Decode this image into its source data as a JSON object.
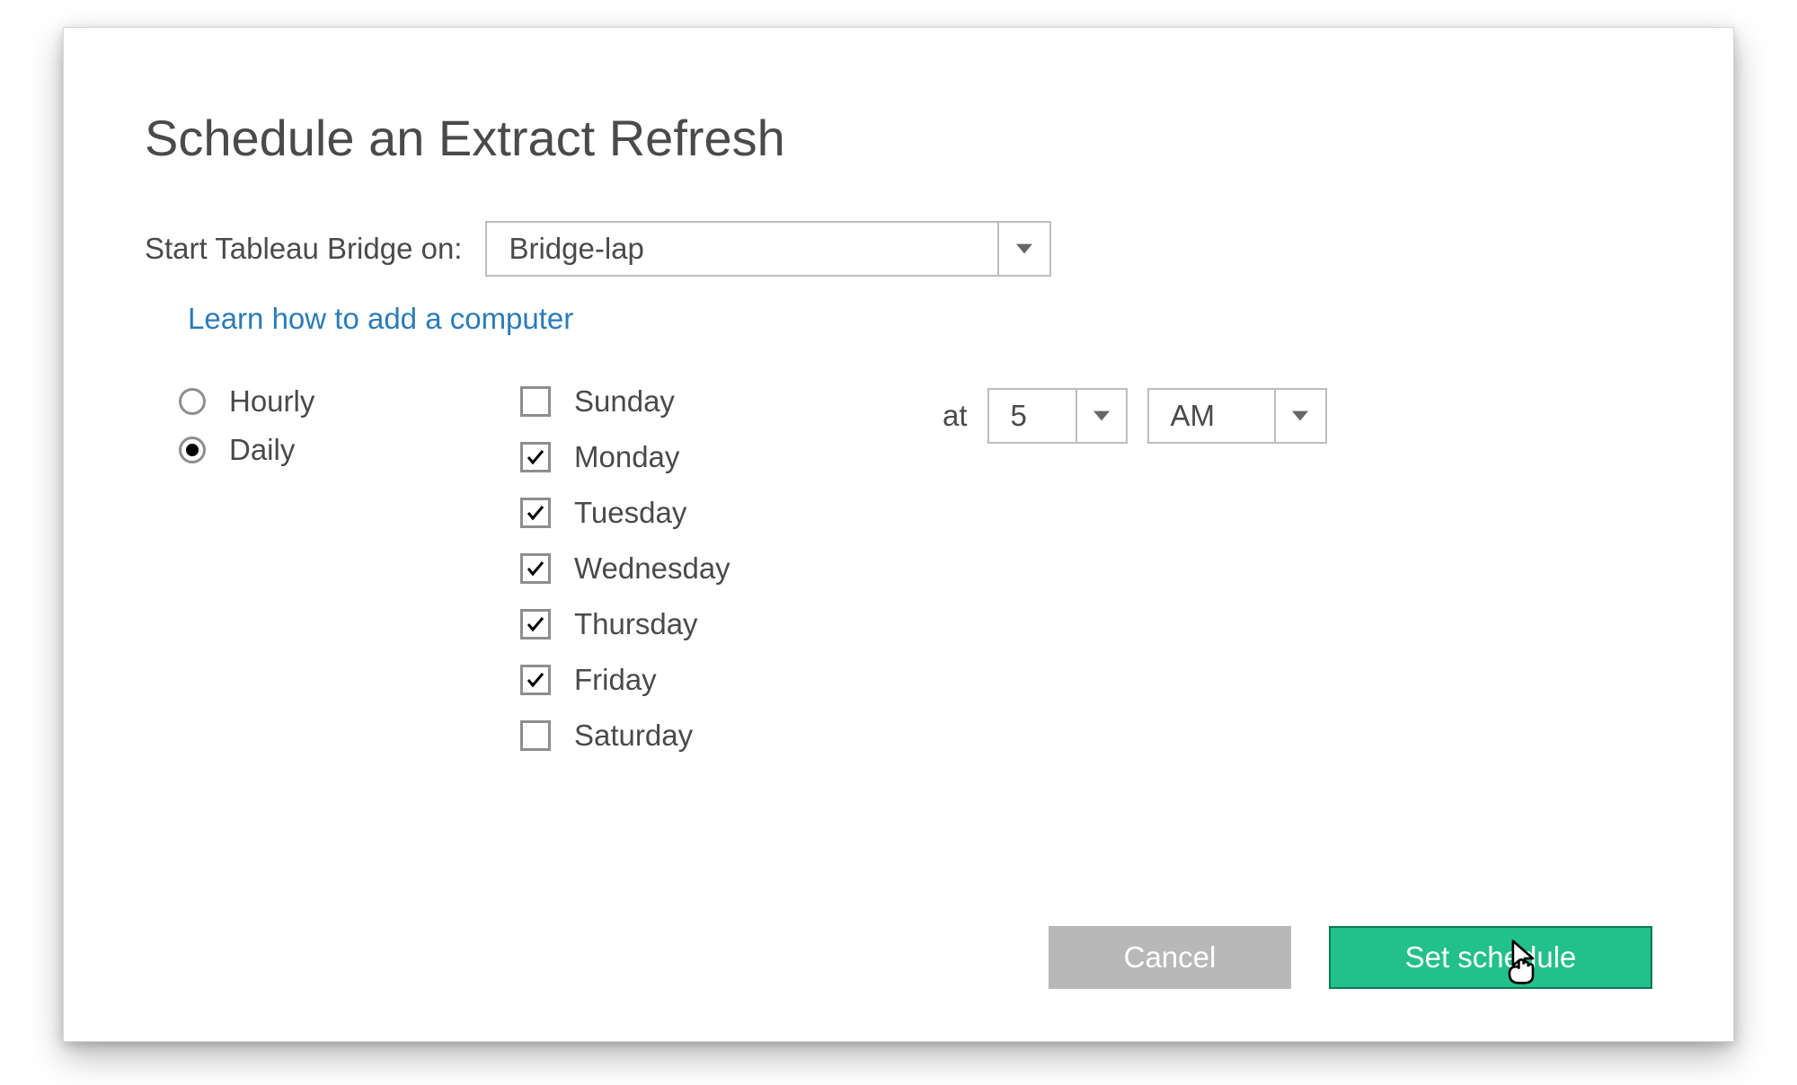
{
  "title": "Schedule an Extract Refresh",
  "start_label": "Start Tableau Bridge on:",
  "bridge_dropdown": {
    "value": "Bridge-lap"
  },
  "learn_link": "Learn how to add a computer",
  "frequency": {
    "options": [
      {
        "label": "Hourly",
        "selected": false
      },
      {
        "label": "Daily",
        "selected": true
      }
    ]
  },
  "days": [
    {
      "label": "Sunday",
      "checked": false
    },
    {
      "label": "Monday",
      "checked": true
    },
    {
      "label": "Tuesday",
      "checked": true
    },
    {
      "label": "Wednesday",
      "checked": true
    },
    {
      "label": "Thursday",
      "checked": true
    },
    {
      "label": "Friday",
      "checked": true
    },
    {
      "label": "Saturday",
      "checked": false
    }
  ],
  "time": {
    "at_label": "at",
    "hour": "5",
    "ampm": "AM"
  },
  "buttons": {
    "cancel": "Cancel",
    "set": "Set schedule"
  }
}
